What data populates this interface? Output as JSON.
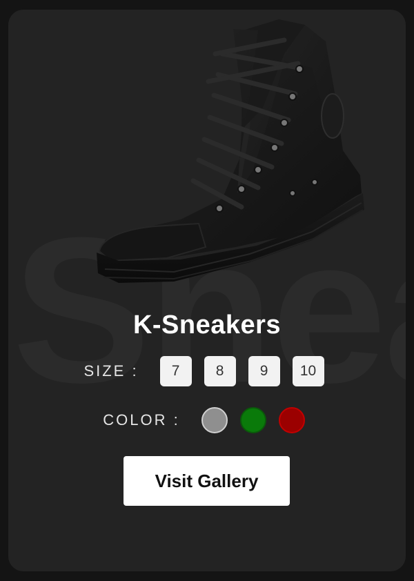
{
  "card": {
    "background_word": "Sneakers",
    "title": "K-Sneakers",
    "size": {
      "label": "SIZE :",
      "options": [
        "7",
        "8",
        "9",
        "10"
      ]
    },
    "color": {
      "label": "COLOR :",
      "swatches": [
        {
          "name": "grey",
          "hex": "#8f8f8f"
        },
        {
          "name": "green",
          "hex": "#0a7a0a"
        },
        {
          "name": "red",
          "hex": "#9b0000"
        }
      ]
    },
    "button_label": "Visit Gallery",
    "product_image": "black-high-top-sneaker"
  }
}
